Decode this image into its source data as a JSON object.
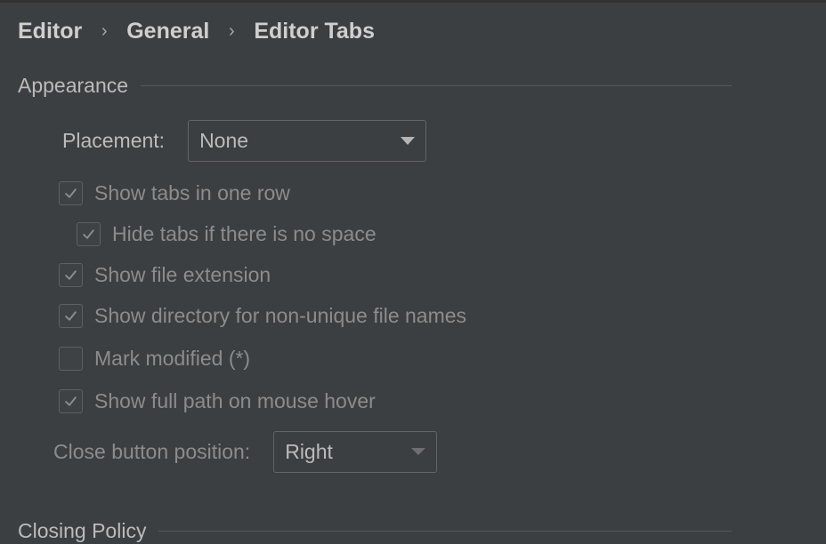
{
  "breadcrumb": {
    "items": [
      "Editor",
      "General",
      "Editor Tabs"
    ],
    "separator": "›"
  },
  "appearance": {
    "title": "Appearance",
    "placement_label": "Placement:",
    "placement_value": "None",
    "checkboxes": [
      {
        "label": "Show tabs in one row",
        "checked": true,
        "enabled": false
      },
      {
        "label": "Hide tabs if there is no space",
        "checked": true,
        "enabled": false
      },
      {
        "label": "Show file extension",
        "checked": true,
        "enabled": false
      },
      {
        "label": "Show directory for non-unique file names",
        "checked": true,
        "enabled": false
      },
      {
        "label": "Mark modified (*)",
        "checked": false,
        "enabled": false
      },
      {
        "label": "Show full path on mouse hover",
        "checked": true,
        "enabled": false
      }
    ],
    "close_button_label": "Close button position:",
    "close_button_value": "Right"
  },
  "closing_policy": {
    "title": "Closing Policy"
  },
  "colors": {
    "background": "#3c3f41",
    "text": "#bbbbbb",
    "text_disabled": "#8c8c8c",
    "border": "#646464",
    "check": "#8c8c8c"
  }
}
